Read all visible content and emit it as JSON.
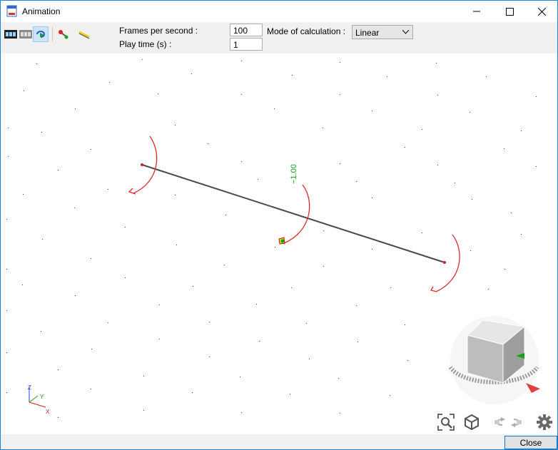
{
  "window": {
    "title": "Animation",
    "controls": {
      "minimize": "minimize-icon",
      "maximize": "maximize-icon",
      "close": "close-icon"
    }
  },
  "toolbar": {
    "icons": [
      "film-frames-icon",
      "film-strip-icon",
      "loop-play-icon",
      "deform-red-icon",
      "deform-yellow-icon"
    ],
    "frames_label": "Frames per second :",
    "frames_value": "100",
    "playtime_label": "Play time (s) :",
    "playtime_value": "1",
    "mode_label": "Mode of calculation :",
    "mode_value": "Linear"
  },
  "viewport": {
    "load_label": "−1.00",
    "axis_labels": {
      "z": "Z",
      "y": "Y",
      "x": "X"
    },
    "colors": {
      "member": "#4a4a4a",
      "moment": "#e0282c",
      "load_text": "#1aa01a",
      "grid": "#444444"
    }
  },
  "bottom_tools": [
    "zoom-icon",
    "view-cube-icon",
    "rotate-left-icon",
    "rotate-right-icon",
    "settings-gear-icon"
  ],
  "footer": {
    "close_label": "Close"
  }
}
